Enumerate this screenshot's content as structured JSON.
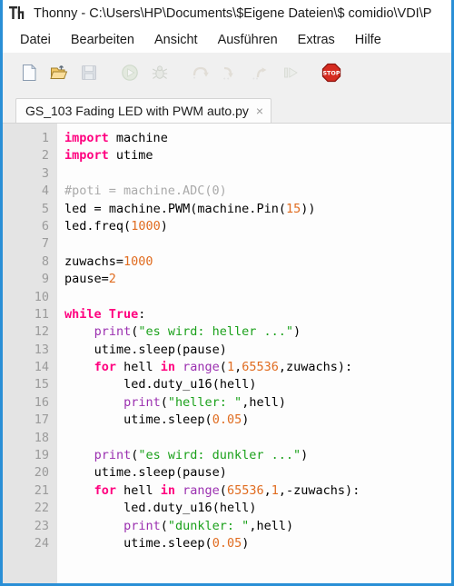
{
  "window": {
    "app_name": "Thonny",
    "logo_text": "Th",
    "title": "Thonny  -  C:\\Users\\HP\\Documents\\$Eigene Dateien\\$ comidio\\VDI\\P",
    "border_color": "#2a8fd6"
  },
  "menubar": {
    "items": [
      {
        "label": "Datei"
      },
      {
        "label": "Bearbeiten"
      },
      {
        "label": "Ansicht"
      },
      {
        "label": "Ausführen"
      },
      {
        "label": "Extras"
      },
      {
        "label": "Hilfe"
      }
    ]
  },
  "toolbar": {
    "buttons": [
      {
        "name": "new-file-icon",
        "title": "Neu",
        "enabled": true
      },
      {
        "name": "open-file-icon",
        "title": "Öffnen",
        "enabled": true
      },
      {
        "name": "save-file-icon",
        "title": "Speichern",
        "enabled": false
      },
      {
        "name": "run-icon",
        "title": "Ausführen",
        "enabled": false
      },
      {
        "name": "debug-icon",
        "title": "Debug",
        "enabled": false
      },
      {
        "name": "step-over-icon",
        "title": "Step over",
        "enabled": false
      },
      {
        "name": "step-into-icon",
        "title": "Step into",
        "enabled": false
      },
      {
        "name": "step-out-icon",
        "title": "Step out",
        "enabled": false
      },
      {
        "name": "resume-icon",
        "title": "Resume",
        "enabled": false
      },
      {
        "name": "stop-icon",
        "title": "Stop",
        "enabled": true
      }
    ]
  },
  "tabs": [
    {
      "label": "GS_103 Fading LED with PWM auto.py",
      "close_glyph": "×",
      "active": true
    }
  ],
  "editor": {
    "line_numbers": [
      1,
      2,
      3,
      4,
      5,
      6,
      7,
      8,
      9,
      10,
      11,
      12,
      13,
      14,
      15,
      16,
      17,
      18,
      19,
      20,
      21,
      22,
      23,
      24
    ],
    "colors": {
      "keyword": "#ff007f",
      "builtin": "#9b30b0",
      "number": "#e06c20",
      "string": "#1ba11b",
      "comment": "#aaaaaa",
      "text": "#000000",
      "gutter_bg": "#e4e4e4",
      "gutter_fg": "#9b9b9b",
      "background": "#fdfdfd"
    },
    "lines": [
      {
        "n": 1,
        "text": "import machine"
      },
      {
        "n": 2,
        "text": "import utime"
      },
      {
        "n": 3,
        "text": ""
      },
      {
        "n": 4,
        "text": "#poti = machine.ADC(0)"
      },
      {
        "n": 5,
        "text": "led = machine.PWM(machine.Pin(15))"
      },
      {
        "n": 6,
        "text": "led.freq(1000)"
      },
      {
        "n": 7,
        "text": ""
      },
      {
        "n": 8,
        "text": "zuwachs=1000"
      },
      {
        "n": 9,
        "text": "pause=2"
      },
      {
        "n": 10,
        "text": ""
      },
      {
        "n": 11,
        "text": "while True:"
      },
      {
        "n": 12,
        "text": "    print(\"es wird: heller ...\")"
      },
      {
        "n": 13,
        "text": "    utime.sleep(pause)"
      },
      {
        "n": 14,
        "text": "    for hell in range(1,65536,zuwachs):"
      },
      {
        "n": 15,
        "text": "        led.duty_u16(hell)"
      },
      {
        "n": 16,
        "text": "        print(\"heller: \",hell)"
      },
      {
        "n": 17,
        "text": "        utime.sleep(0.05)"
      },
      {
        "n": 18,
        "text": ""
      },
      {
        "n": 19,
        "text": "    print(\"es wird: dunkler ...\")"
      },
      {
        "n": 20,
        "text": "    utime.sleep(pause)"
      },
      {
        "n": 21,
        "text": "    for hell in range(65536,1,-zuwachs):"
      },
      {
        "n": 22,
        "text": "        led.duty_u16(hell)"
      },
      {
        "n": 23,
        "text": "        print(\"dunkler: \",hell)"
      },
      {
        "n": 24,
        "text": "        utime.sleep(0.05)"
      }
    ]
  }
}
